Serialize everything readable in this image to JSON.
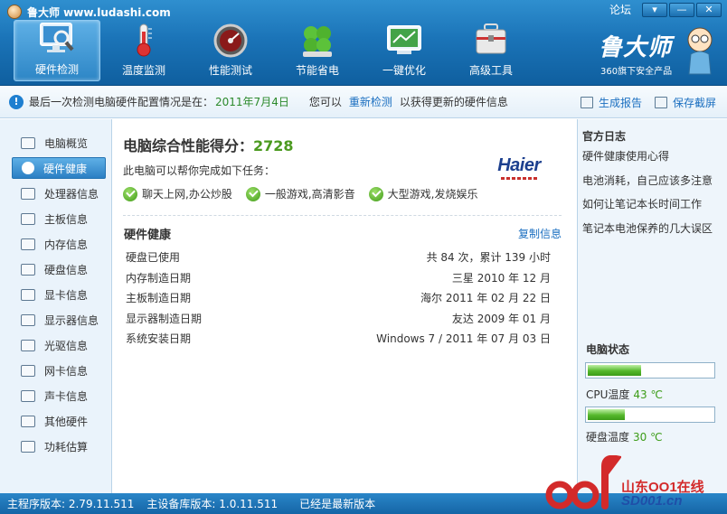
{
  "app": {
    "title": "鲁大师 www.ludashi.com",
    "forum_label": "论坛",
    "brand_name": "鲁大师",
    "brand_sub": "360旗下安全产品"
  },
  "window_controls": {
    "menu": "▾",
    "minimize": "—",
    "close": "✕"
  },
  "nav": {
    "tabs": [
      {
        "label": "硬件检测",
        "icon": "monitor-magnifier-icon",
        "active": true
      },
      {
        "label": "温度监测",
        "icon": "thermometer-icon",
        "active": false
      },
      {
        "label": "性能测试",
        "icon": "speedometer-icon",
        "active": false
      },
      {
        "label": "节能省电",
        "icon": "clover-icon",
        "active": false
      },
      {
        "label": "一键优化",
        "icon": "screen-optimize-icon",
        "active": false
      },
      {
        "label": "高级工具",
        "icon": "toolbox-icon",
        "active": false
      }
    ]
  },
  "infobar": {
    "text": "最后一次检测电脑硬件配置情况是在：",
    "date": "2011年7月4日",
    "hint": "您可以",
    "link": "重新检测",
    "after": "以获得更新的硬件信息",
    "actions": [
      {
        "label": "生成报告",
        "icon": "report-icon"
      },
      {
        "label": "保存截屏",
        "icon": "camera-icon"
      }
    ]
  },
  "sidebar": {
    "items": [
      {
        "label": "电脑概览",
        "icon": "computer-overview-icon",
        "active": false
      },
      {
        "label": "硬件健康",
        "icon": "health-plus-icon",
        "active": true
      },
      {
        "label": "处理器信息",
        "icon": "cpu-icon",
        "active": false
      },
      {
        "label": "主板信息",
        "icon": "motherboard-icon",
        "active": false
      },
      {
        "label": "内存信息",
        "icon": "memory-icon",
        "active": false
      },
      {
        "label": "硬盘信息",
        "icon": "harddisk-icon",
        "active": false
      },
      {
        "label": "显卡信息",
        "icon": "graphics-card-icon",
        "active": false
      },
      {
        "label": "显示器信息",
        "icon": "display-icon",
        "active": false
      },
      {
        "label": "光驱信息",
        "icon": "optical-drive-icon",
        "active": false
      },
      {
        "label": "网卡信息",
        "icon": "network-card-icon",
        "active": false
      },
      {
        "label": "声卡信息",
        "icon": "sound-card-icon",
        "active": false
      },
      {
        "label": "其他硬件",
        "icon": "other-hardware-icon",
        "active": false
      },
      {
        "label": "功耗估算",
        "icon": "power-estimate-icon",
        "active": false
      }
    ]
  },
  "main": {
    "score_label": "电脑综合性能得分：",
    "score_value": "2728",
    "brand_logo": "Haier",
    "tasks_intro": "此电脑可以帮你完成如下任务：",
    "tasks": [
      "聊天上网,办公炒股",
      "一般游戏,高清影音",
      "大型游戏,发烧娱乐"
    ],
    "section_title": "硬件健康",
    "copy_link": "复制信息",
    "rows": [
      {
        "label": "硬盘已使用",
        "value": "共 84 次，累计 139 小时"
      },
      {
        "label": "内存制造日期",
        "value": "三星 2010 年 12 月"
      },
      {
        "label": "主板制造日期",
        "value": "海尔 2011 年 02 月 22 日"
      },
      {
        "label": "显示器制造日期",
        "value": "友达 2009 年 01 月"
      },
      {
        "label": "系统安装日期",
        "value": "Windows 7 / 2011 年 07 月 03 日"
      }
    ]
  },
  "right": {
    "log_title": "官方日志",
    "logs": [
      "硬件健康使用心得",
      "电池消耗，自己应该多注意",
      "如何让笔记本长时间工作",
      "笔记本电池保养的几大误区"
    ],
    "status_title": "电脑状态",
    "meters": [
      {
        "label": "CPU温度",
        "value": "43 ℃",
        "level": 0.43
      },
      {
        "label": "硬盘温度",
        "value": "30 ℃",
        "level": 0.3
      }
    ]
  },
  "statusbar": {
    "main_version": "主程序版本: 2.79.11.511",
    "db_version": "主设备库版本: 1.0.11.511",
    "latest": "已经是最新版本"
  },
  "watermark": {
    "cn": "山东OO1在线",
    "en": "SD001.cn"
  }
}
